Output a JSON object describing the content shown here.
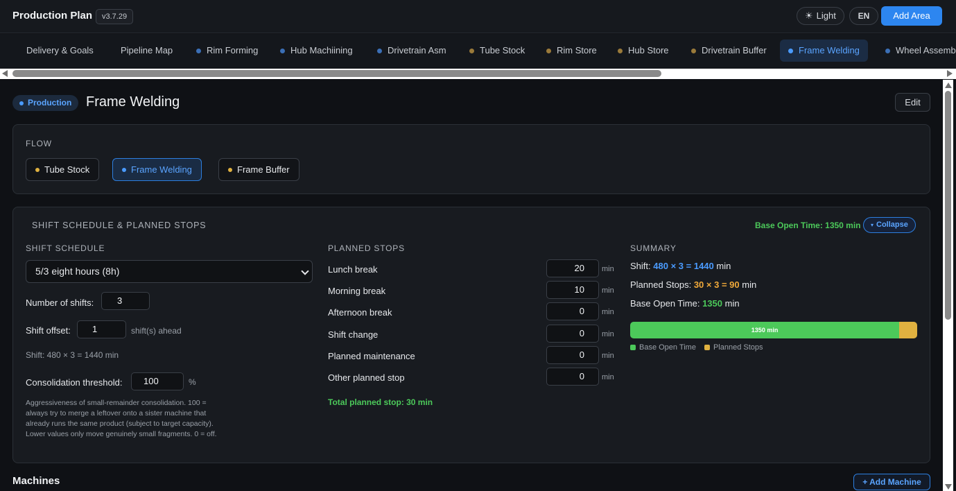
{
  "header": {
    "title": "Production Plan",
    "version": "v3.7.29",
    "theme_label": "Light",
    "lang_label": "EN",
    "add_area_label": "Add Area"
  },
  "tabs": [
    {
      "label": "Delivery & Goals",
      "dot": ""
    },
    {
      "label": "Pipeline Map",
      "dot": ""
    },
    {
      "label": "Rim Forming",
      "dot": "#3b6fb6"
    },
    {
      "label": "Hub Machiining",
      "dot": "#3b6fb6"
    },
    {
      "label": "Drivetrain Asm",
      "dot": "#3b6fb6"
    },
    {
      "label": "Tube Stock",
      "dot": "#9a7a3a"
    },
    {
      "label": "Rim Store",
      "dot": "#9a7a3a"
    },
    {
      "label": "Hub Store",
      "dot": "#9a7a3a"
    },
    {
      "label": "Drivetrain Buffer",
      "dot": "#9a7a3a"
    },
    {
      "label": "Frame Welding",
      "dot": "#4a9bff",
      "active": true
    },
    {
      "label": "Wheel Assemb",
      "dot": "#3b6fb6"
    }
  ],
  "page": {
    "badge": "Production",
    "title": "Frame Welding",
    "edit_label": "Edit"
  },
  "flow": {
    "caption": "FLOW",
    "items": [
      {
        "label": "Tube Stock",
        "dot": "#e0b140"
      },
      {
        "label": "Frame Welding",
        "dot": "#4a9bff",
        "active": true
      },
      {
        "label": "Frame Buffer",
        "dot": "#e0b140"
      }
    ]
  },
  "shift": {
    "caption": "SHIFT SCHEDULE & PLANNED STOPS",
    "base_open_header": "Base Open Time: 1350 min",
    "collapse_label": "Collapse",
    "schedule_caption": "SHIFT SCHEDULE",
    "schedule_value": "5/3 eight hours (8h)",
    "num_shifts_label": "Number of shifts:",
    "num_shifts_value": "3",
    "offset_label": "Shift offset:",
    "offset_value": "1",
    "offset_suffix": "shift(s) ahead",
    "shift_formula": "Shift: 480 × 3 = 1440 min",
    "consolidation_label": "Consolidation threshold:",
    "consolidation_value": "100",
    "consolidation_unit": "%",
    "description": "Aggressiveness of small-remainder consolidation. 100 = always try to merge a leftover onto a sister machine that already runs the same product (subject to target capacity). Lower values only move genuinely small fragments. 0 = off."
  },
  "stops": {
    "caption": "PLANNED STOPS",
    "unit": "min",
    "items": [
      {
        "label": "Lunch break",
        "value": "20"
      },
      {
        "label": "Morning break",
        "value": "10"
      },
      {
        "label": "Afternoon break",
        "value": "0"
      },
      {
        "label": "Shift change",
        "value": "0"
      },
      {
        "label": "Planned maintenance",
        "value": "0"
      },
      {
        "label": "Other planned stop",
        "value": "0"
      }
    ],
    "total": "Total planned stop: 30 min"
  },
  "summary": {
    "caption": "SUMMARY",
    "shift_prefix": "Shift:",
    "shift_a": "480",
    "shift_b": "3",
    "shift_total": "1440",
    "stops_prefix": "Planned Stops:",
    "stops_a": "30",
    "stops_b": "3",
    "stops_total": "90",
    "base_prefix": "Base Open Time:",
    "base_value": "1350",
    "unit": "min",
    "bar_label": "1350 min",
    "bar_open_fraction": 0.9375,
    "legend_open": "Base Open Time",
    "legend_stops": "Planned Stops",
    "colors": {
      "open": "#4cc95a",
      "stops": "#e0b140"
    }
  },
  "machines": {
    "title": "Machines",
    "add_label": "+ Add Machine"
  }
}
